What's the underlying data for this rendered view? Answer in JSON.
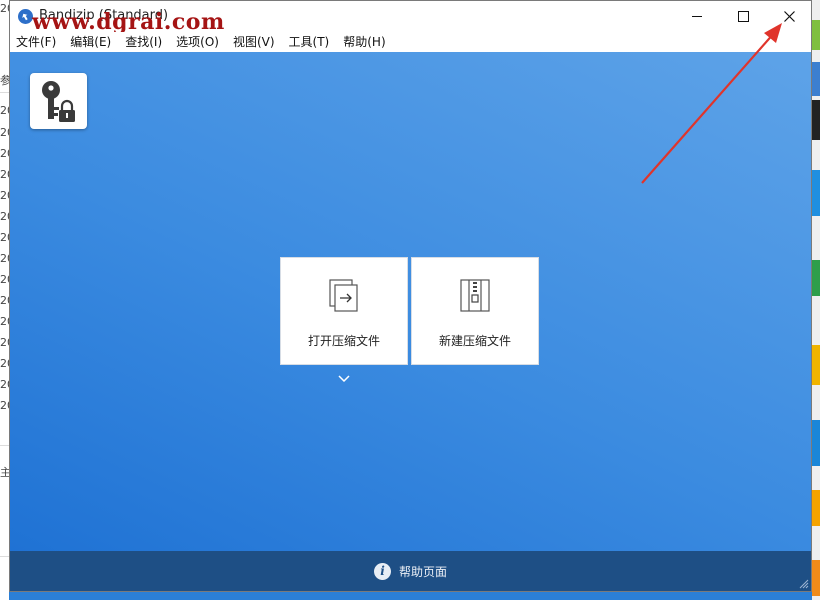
{
  "window": {
    "title": "Bandizip (Standard)",
    "watermark": "www.dgrai.com",
    "minimize_symbol": "—",
    "maximize_symbol": "☐",
    "close_symbol": "✕"
  },
  "menu": [
    {
      "label": "文件(F)"
    },
    {
      "label": "编辑(E)"
    },
    {
      "label": "查找(I)"
    },
    {
      "label": "选项(O)"
    },
    {
      "label": "视图(V)"
    },
    {
      "label": "工具(T)"
    },
    {
      "label": "帮助(H)"
    }
  ],
  "main": {
    "open_archive_label": "打开压缩文件",
    "new_archive_label": "新建压缩文件",
    "key_tile_icon": "key-lock-icon"
  },
  "footer": {
    "help_label": "帮助页面",
    "info_symbol": "i"
  },
  "background": {
    "left_rows": [
      "20",
      "20",
      "20",
      "20",
      "20",
      "20",
      "20",
      "20",
      "20",
      "20",
      "20",
      "20",
      "20",
      "20",
      "20",
      "20"
    ],
    "left_top_char": "参",
    "left_mid_char": "主"
  },
  "colors": {
    "accent": "#2b7fd6",
    "footer": "#1e4f85",
    "annotation_arrow": "#e0342b",
    "watermark": "#a51414"
  }
}
